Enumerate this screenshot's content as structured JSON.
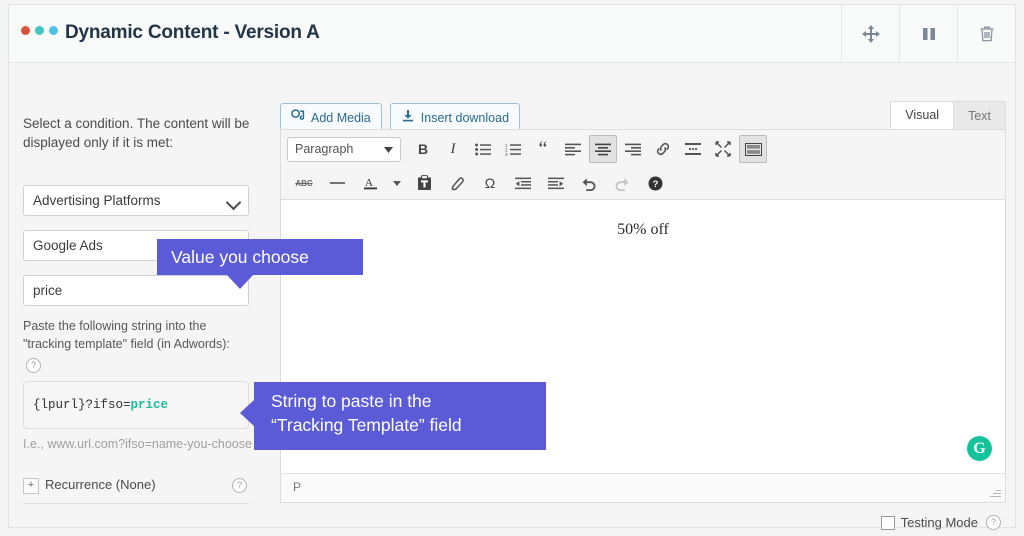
{
  "header": {
    "title": "Dynamic Content - Version A",
    "dots": [
      "dot-red",
      "dot-teal",
      "dot-blue"
    ],
    "buttons": [
      {
        "name": "move-button",
        "icon": "move-arrows-icon",
        "label": "Move"
      },
      {
        "name": "pause-button",
        "icon": "pause-icon",
        "label": "Pause"
      },
      {
        "name": "delete-button",
        "icon": "trash-icon",
        "label": "Delete"
      }
    ]
  },
  "sidebar": {
    "lead_text": "Select a condition. The content will be displayed only if it is met:",
    "condition_select": "Advertising Platforms",
    "platform_field": "Google Ads",
    "value_field": "price",
    "paste_label": "Paste the following string into the \"tracking template\" field (in Adwords):",
    "help_glyph": "?",
    "code_prefix": "{lpurl}?ifso=",
    "code_value": "price",
    "example_note": "I.e., www.url.com?ifso=name-you-choose",
    "recurrence_label": "Recurrence (None)",
    "recurrence_toggle": "+"
  },
  "editor": {
    "add_media": "Add Media",
    "insert_download": "Insert download",
    "tabs": [
      {
        "label": "Visual",
        "active": true
      },
      {
        "label": "Text",
        "active": false
      }
    ],
    "format_select": "Paragraph",
    "toolbar_row1": [
      {
        "name": "bold-icon",
        "glyph": "B",
        "active": false
      },
      {
        "name": "italic-icon",
        "glyph": "I",
        "active": false
      },
      {
        "name": "bulleted-list-icon",
        "glyph": "list-ul",
        "active": false
      },
      {
        "name": "numbered-list-icon",
        "glyph": "list-ol",
        "active": false
      },
      {
        "name": "blockquote-icon",
        "glyph": "“",
        "active": false
      },
      {
        "name": "align-left-icon",
        "glyph": "align-left",
        "active": false
      },
      {
        "name": "align-center-icon",
        "glyph": "align-center",
        "active": true
      },
      {
        "name": "align-right-icon",
        "glyph": "align-right",
        "active": false
      },
      {
        "name": "insert-link-icon",
        "glyph": "link",
        "active": false
      },
      {
        "name": "read-more-icon",
        "glyph": "more",
        "active": false
      },
      {
        "name": "fullscreen-icon",
        "glyph": "expand",
        "active": false
      },
      {
        "name": "toolbar-toggle-icon",
        "glyph": "kitchen-sink",
        "active": true
      }
    ],
    "toolbar_row2": [
      {
        "name": "strikethrough-icon",
        "glyph": "ABC",
        "active": false
      },
      {
        "name": "horizontal-rule-icon",
        "glyph": "—",
        "active": false
      },
      {
        "name": "text-color-icon",
        "glyph": "A",
        "active": false
      },
      {
        "name": "text-color-dropdown-icon",
        "glyph": "▾",
        "active": false
      },
      {
        "name": "paste-as-text-icon",
        "glyph": "clipboard",
        "active": false
      },
      {
        "name": "clear-formatting-icon",
        "glyph": "eraser",
        "active": false
      },
      {
        "name": "special-character-icon",
        "glyph": "Ω",
        "active": false
      },
      {
        "name": "outdent-icon",
        "glyph": "outdent",
        "active": false
      },
      {
        "name": "indent-icon",
        "glyph": "indent",
        "active": false
      },
      {
        "name": "undo-icon",
        "glyph": "undo",
        "active": false
      },
      {
        "name": "redo-icon",
        "glyph": "redo",
        "active": false,
        "disabled": true
      },
      {
        "name": "help-icon",
        "glyph": "?",
        "active": false
      }
    ],
    "content": "50% off",
    "status_path": "P",
    "grammarly_badge": "G"
  },
  "footer": {
    "testing_mode_label": "Testing Mode",
    "testing_mode_checked": false,
    "help_glyph": "?"
  },
  "callouts": [
    {
      "name": "callout-value-you-choose",
      "text": "Value you choose"
    },
    {
      "name": "callout-tracking-template",
      "line1": "String to paste in the",
      "line2": "“Tracking Template” field"
    }
  ],
  "colors": {
    "accent_purple": "#5b5bd8",
    "code_highlight": "#19bc9c",
    "grammarly_green": "#15c39a",
    "link_blue": "#2b6b8f"
  }
}
